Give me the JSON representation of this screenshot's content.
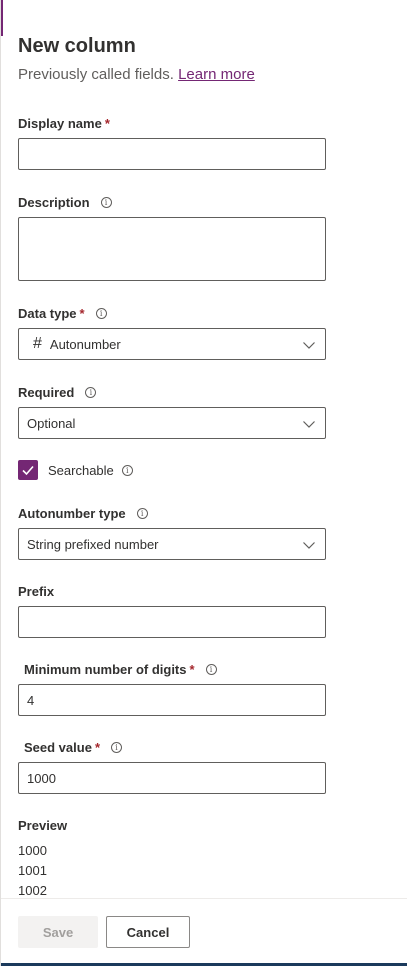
{
  "panel": {
    "title": "New column",
    "subtitle": "Previously called fields.",
    "learn_more": "Learn more"
  },
  "fields": {
    "display_name": {
      "label": "Display name",
      "required": "*",
      "value": ""
    },
    "description": {
      "label": "Description",
      "value": ""
    },
    "data_type": {
      "label": "Data type",
      "required": "*",
      "icon": "#",
      "value": "Autonumber"
    },
    "required": {
      "label": "Required",
      "value": "Optional"
    },
    "searchable": {
      "label": "Searchable",
      "checked": true
    },
    "autonumber_type": {
      "label": "Autonumber type",
      "value": "String prefixed number"
    },
    "prefix": {
      "label": "Prefix",
      "value": ""
    },
    "min_digits": {
      "label": "Minimum number of digits",
      "required": "*",
      "value": "4"
    },
    "seed_value": {
      "label": "Seed value",
      "required": "*",
      "value": "1000"
    }
  },
  "preview": {
    "label": "Preview",
    "values": [
      "1000",
      "1001",
      "1002"
    ]
  },
  "footer": {
    "save_label": "Save",
    "cancel_label": "Cancel"
  },
  "colors": {
    "accent": "#742774",
    "required": "#a4262c"
  },
  "icons": {
    "info": "info-icon",
    "chevron": "chevron-down-icon",
    "check": "checkmark-icon",
    "number": "number-icon"
  }
}
